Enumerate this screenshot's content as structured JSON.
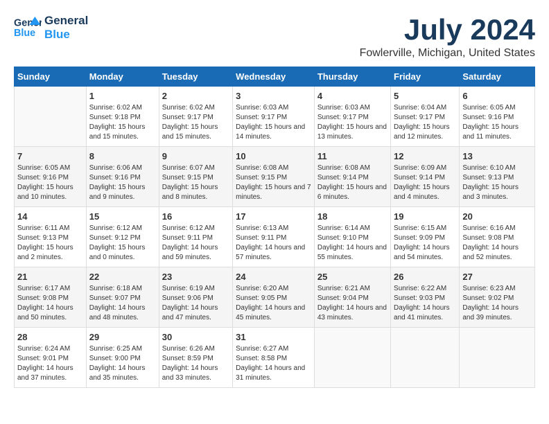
{
  "header": {
    "logo_line1": "General",
    "logo_line2": "Blue",
    "month_title": "July 2024",
    "location": "Fowlerville, Michigan, United States"
  },
  "days_of_week": [
    "Sunday",
    "Monday",
    "Tuesday",
    "Wednesday",
    "Thursday",
    "Friday",
    "Saturday"
  ],
  "weeks": [
    [
      {
        "day": "",
        "sunrise": "",
        "sunset": "",
        "daylight": ""
      },
      {
        "day": "1",
        "sunrise": "Sunrise: 6:02 AM",
        "sunset": "Sunset: 9:18 PM",
        "daylight": "Daylight: 15 hours and 15 minutes."
      },
      {
        "day": "2",
        "sunrise": "Sunrise: 6:02 AM",
        "sunset": "Sunset: 9:17 PM",
        "daylight": "Daylight: 15 hours and 15 minutes."
      },
      {
        "day": "3",
        "sunrise": "Sunrise: 6:03 AM",
        "sunset": "Sunset: 9:17 PM",
        "daylight": "Daylight: 15 hours and 14 minutes."
      },
      {
        "day": "4",
        "sunrise": "Sunrise: 6:03 AM",
        "sunset": "Sunset: 9:17 PM",
        "daylight": "Daylight: 15 hours and 13 minutes."
      },
      {
        "day": "5",
        "sunrise": "Sunrise: 6:04 AM",
        "sunset": "Sunset: 9:17 PM",
        "daylight": "Daylight: 15 hours and 12 minutes."
      },
      {
        "day": "6",
        "sunrise": "Sunrise: 6:05 AM",
        "sunset": "Sunset: 9:16 PM",
        "daylight": "Daylight: 15 hours and 11 minutes."
      }
    ],
    [
      {
        "day": "7",
        "sunrise": "Sunrise: 6:05 AM",
        "sunset": "Sunset: 9:16 PM",
        "daylight": "Daylight: 15 hours and 10 minutes."
      },
      {
        "day": "8",
        "sunrise": "Sunrise: 6:06 AM",
        "sunset": "Sunset: 9:16 PM",
        "daylight": "Daylight: 15 hours and 9 minutes."
      },
      {
        "day": "9",
        "sunrise": "Sunrise: 6:07 AM",
        "sunset": "Sunset: 9:15 PM",
        "daylight": "Daylight: 15 hours and 8 minutes."
      },
      {
        "day": "10",
        "sunrise": "Sunrise: 6:08 AM",
        "sunset": "Sunset: 9:15 PM",
        "daylight": "Daylight: 15 hours and 7 minutes."
      },
      {
        "day": "11",
        "sunrise": "Sunrise: 6:08 AM",
        "sunset": "Sunset: 9:14 PM",
        "daylight": "Daylight: 15 hours and 6 minutes."
      },
      {
        "day": "12",
        "sunrise": "Sunrise: 6:09 AM",
        "sunset": "Sunset: 9:14 PM",
        "daylight": "Daylight: 15 hours and 4 minutes."
      },
      {
        "day": "13",
        "sunrise": "Sunrise: 6:10 AM",
        "sunset": "Sunset: 9:13 PM",
        "daylight": "Daylight: 15 hours and 3 minutes."
      }
    ],
    [
      {
        "day": "14",
        "sunrise": "Sunrise: 6:11 AM",
        "sunset": "Sunset: 9:13 PM",
        "daylight": "Daylight: 15 hours and 2 minutes."
      },
      {
        "day": "15",
        "sunrise": "Sunrise: 6:12 AM",
        "sunset": "Sunset: 9:12 PM",
        "daylight": "Daylight: 15 hours and 0 minutes."
      },
      {
        "day": "16",
        "sunrise": "Sunrise: 6:12 AM",
        "sunset": "Sunset: 9:11 PM",
        "daylight": "Daylight: 14 hours and 59 minutes."
      },
      {
        "day": "17",
        "sunrise": "Sunrise: 6:13 AM",
        "sunset": "Sunset: 9:11 PM",
        "daylight": "Daylight: 14 hours and 57 minutes."
      },
      {
        "day": "18",
        "sunrise": "Sunrise: 6:14 AM",
        "sunset": "Sunset: 9:10 PM",
        "daylight": "Daylight: 14 hours and 55 minutes."
      },
      {
        "day": "19",
        "sunrise": "Sunrise: 6:15 AM",
        "sunset": "Sunset: 9:09 PM",
        "daylight": "Daylight: 14 hours and 54 minutes."
      },
      {
        "day": "20",
        "sunrise": "Sunrise: 6:16 AM",
        "sunset": "Sunset: 9:08 PM",
        "daylight": "Daylight: 14 hours and 52 minutes."
      }
    ],
    [
      {
        "day": "21",
        "sunrise": "Sunrise: 6:17 AM",
        "sunset": "Sunset: 9:08 PM",
        "daylight": "Daylight: 14 hours and 50 minutes."
      },
      {
        "day": "22",
        "sunrise": "Sunrise: 6:18 AM",
        "sunset": "Sunset: 9:07 PM",
        "daylight": "Daylight: 14 hours and 48 minutes."
      },
      {
        "day": "23",
        "sunrise": "Sunrise: 6:19 AM",
        "sunset": "Sunset: 9:06 PM",
        "daylight": "Daylight: 14 hours and 47 minutes."
      },
      {
        "day": "24",
        "sunrise": "Sunrise: 6:20 AM",
        "sunset": "Sunset: 9:05 PM",
        "daylight": "Daylight: 14 hours and 45 minutes."
      },
      {
        "day": "25",
        "sunrise": "Sunrise: 6:21 AM",
        "sunset": "Sunset: 9:04 PM",
        "daylight": "Daylight: 14 hours and 43 minutes."
      },
      {
        "day": "26",
        "sunrise": "Sunrise: 6:22 AM",
        "sunset": "Sunset: 9:03 PM",
        "daylight": "Daylight: 14 hours and 41 minutes."
      },
      {
        "day": "27",
        "sunrise": "Sunrise: 6:23 AM",
        "sunset": "Sunset: 9:02 PM",
        "daylight": "Daylight: 14 hours and 39 minutes."
      }
    ],
    [
      {
        "day": "28",
        "sunrise": "Sunrise: 6:24 AM",
        "sunset": "Sunset: 9:01 PM",
        "daylight": "Daylight: 14 hours and 37 minutes."
      },
      {
        "day": "29",
        "sunrise": "Sunrise: 6:25 AM",
        "sunset": "Sunset: 9:00 PM",
        "daylight": "Daylight: 14 hours and 35 minutes."
      },
      {
        "day": "30",
        "sunrise": "Sunrise: 6:26 AM",
        "sunset": "Sunset: 8:59 PM",
        "daylight": "Daylight: 14 hours and 33 minutes."
      },
      {
        "day": "31",
        "sunrise": "Sunrise: 6:27 AM",
        "sunset": "Sunset: 8:58 PM",
        "daylight": "Daylight: 14 hours and 31 minutes."
      },
      {
        "day": "",
        "sunrise": "",
        "sunset": "",
        "daylight": ""
      },
      {
        "day": "",
        "sunrise": "",
        "sunset": "",
        "daylight": ""
      },
      {
        "day": "",
        "sunrise": "",
        "sunset": "",
        "daylight": ""
      }
    ]
  ]
}
